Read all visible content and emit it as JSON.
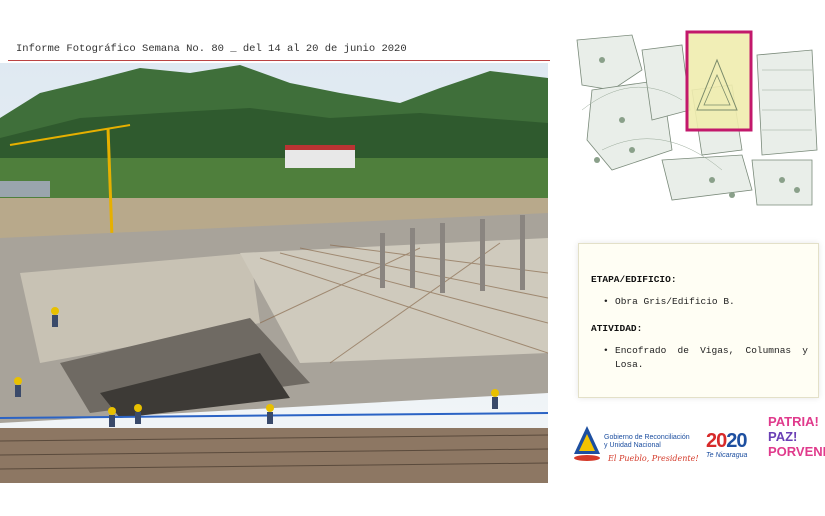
{
  "header": {
    "title": "Informe Fotográfico Semana No. 80 _ del 14 al 20 de junio 2020"
  },
  "photo": {
    "subject": "construction-site-photo"
  },
  "site_map": {
    "highlight_color": "#c2186b"
  },
  "activity_panel": {
    "stage_heading": "ETAPA/EDIFICIO:",
    "stage_items": [
      "Obra Gris/Edificio B."
    ],
    "activity_heading": "ATIVIDAD:",
    "activity_items": [
      "Encofrado de Vigas, Columnas y Losa."
    ]
  },
  "logos": {
    "gov_line1": "Gobierno de Reconciliación",
    "gov_line2": "y Unidad Nacional",
    "gov_slogan": "El Pueblo, Presidente!",
    "year_digit_a": "20",
    "year_digit_b": "20",
    "year_sub": "Te Nicaragua",
    "ppp_1": "PATRIA!",
    "ppp_2": "PAZ!",
    "ppp_3": "PORVENIR!"
  }
}
